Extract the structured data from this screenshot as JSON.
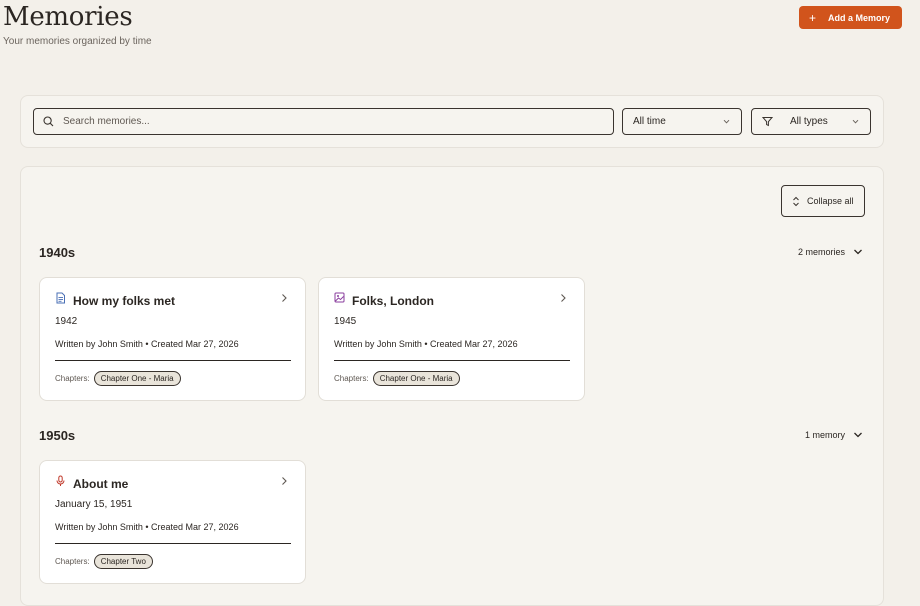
{
  "header": {
    "title": "Memories",
    "subtitle": "Your memories organized by time",
    "add_button_label": "Add a Memory"
  },
  "filters": {
    "search_placeholder": "Search memories...",
    "time_value": "All time",
    "type_value": "All types"
  },
  "timeline": {
    "collapse_label": "Collapse all",
    "decades": [
      {
        "label": "1940s",
        "count_label": "2 memories",
        "memories": [
          {
            "icon": "document-icon",
            "title": "How my folks met",
            "date": "1942",
            "meta": "Written by John Smith • Created Mar 27, 2026",
            "chapters_label": "Chapters:",
            "chapter": "Chapter One - Maria"
          },
          {
            "icon": "image-icon",
            "title": "Folks, London",
            "date": "1945",
            "meta": "Written by John Smith • Created Mar 27, 2026",
            "chapters_label": "Chapters:",
            "chapter": "Chapter One - Maria"
          }
        ]
      },
      {
        "label": "1950s",
        "count_label": "1 memory",
        "memories": [
          {
            "icon": "microphone-icon",
            "title": "About me",
            "date": "January 15, 1951",
            "meta": "Written by John Smith • Created Mar 27, 2026",
            "chapters_label": "Chapters:",
            "chapter": "Chapter Two"
          }
        ]
      }
    ]
  },
  "colors": {
    "background": "#f3f0ea",
    "accent": "#d1541c",
    "document_icon": "#4a6fb5",
    "image_icon": "#8a3d9e",
    "microphone_icon": "#c0392b"
  }
}
